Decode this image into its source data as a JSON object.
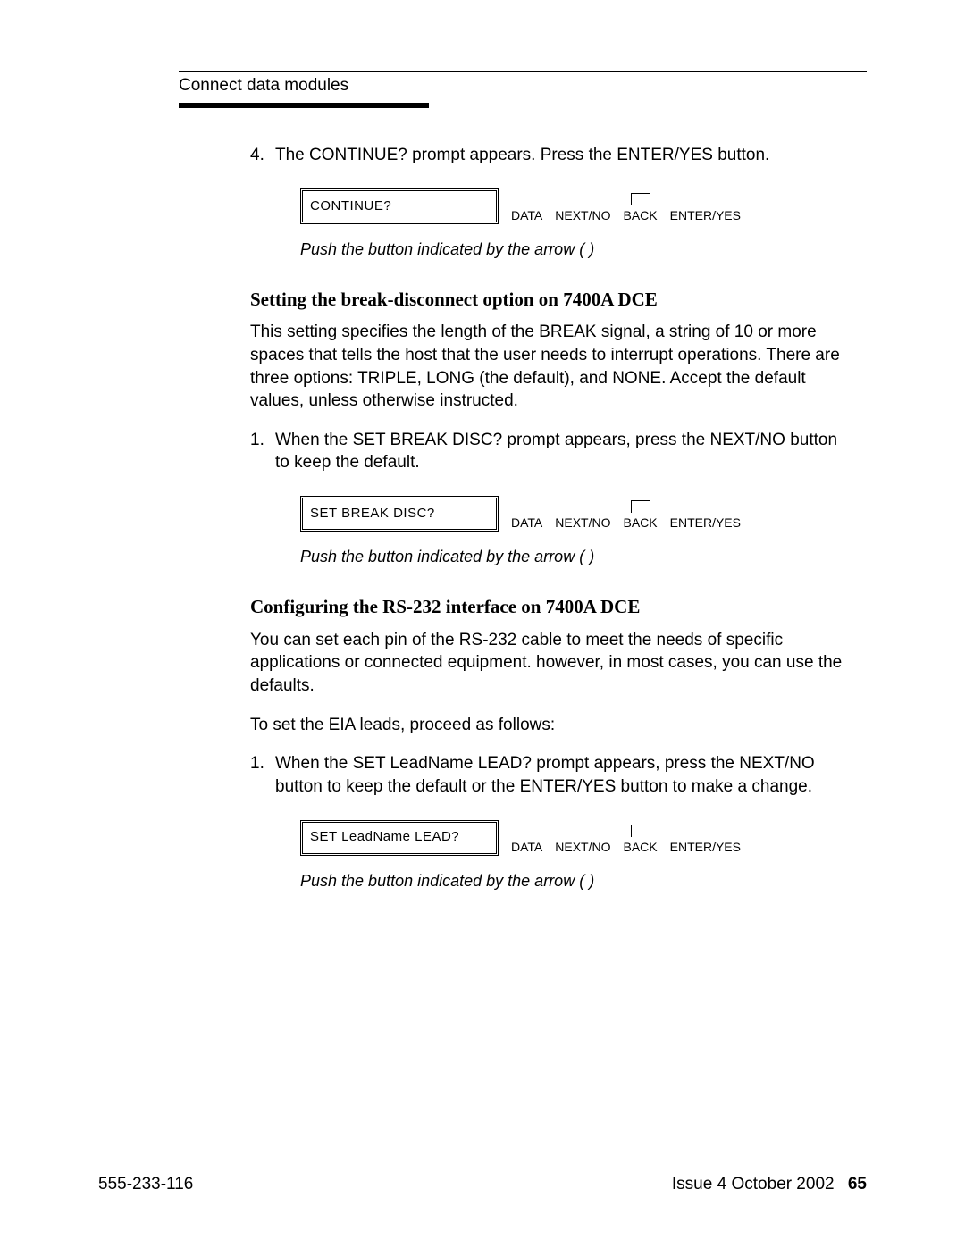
{
  "header": {
    "section": "Connect data modules"
  },
  "step4": {
    "num": "4.",
    "text": "The CONTINUE? prompt appears. Press the ENTER/YES button.",
    "lcd": "CONTINUE?",
    "caption": "Push the button indicated by the arrow (    )"
  },
  "buttons": {
    "data": "DATA",
    "nextno": "NEXT/NO",
    "back": "BACK",
    "enteryes": "ENTER/YES"
  },
  "sectionA": {
    "heading": "Setting the break-disconnect option on 7400A DCE",
    "para": "This setting specifies the length of the BREAK signal, a string of 10 or more spaces that tells the host that the user needs to interrupt operations. There are three options: TRIPLE, LONG (the default), and NONE. Accept the default values, unless otherwise instructed.",
    "item1_num": "1.",
    "item1_text": "When the SET BREAK DISC?  prompt appears, press the NEXT/NO button to keep the default.",
    "lcd": "SET  BREAK DISC?",
    "caption": "Push the button indicated by the arrow (    )"
  },
  "sectionB": {
    "heading": "Configuring the RS-232 interface on 7400A DCE",
    "para1": "You can set each pin of the RS-232 cable to meet the needs of specific applications or connected equipment. however, in most cases, you can use the defaults.",
    "para2": "To set the EIA leads, proceed as follows:",
    "item1_num": "1.",
    "item1_text": "When the SET LeadName  LEAD?  prompt appears, press the NEXT/NO button to keep the default or the ENTER/YES button to make a change.",
    "lcd": "SET  LeadName  LEAD?",
    "caption": "Push the button indicated by the arrow (    )"
  },
  "footer": {
    "doc": "555-233-116",
    "issue": "Issue 4   October 2002",
    "page": "65"
  }
}
